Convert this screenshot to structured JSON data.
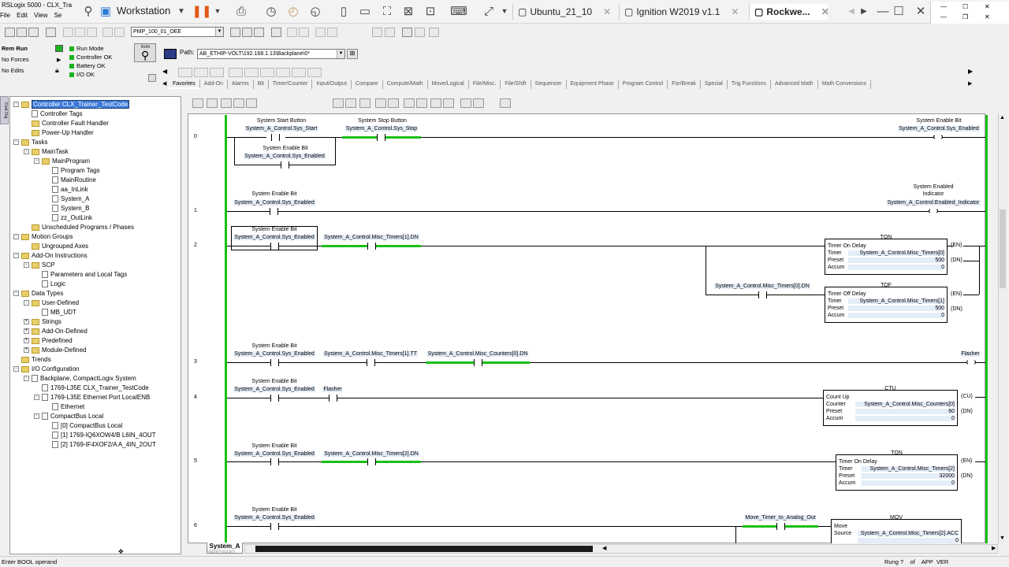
{
  "app": {
    "title": "RSLogix 5000 - CLX_Tra",
    "menu": [
      "File",
      "Edit",
      "View",
      "Se"
    ]
  },
  "vm": {
    "workstation_label": "Workstation",
    "tabs": [
      {
        "label": "Ubuntu_21_10"
      },
      {
        "label": "Ignition W2019 v1.1"
      },
      {
        "label": "Rockwe..."
      }
    ]
  },
  "toolbar": {
    "routine_combo": "PMP_100_01_OEE"
  },
  "controller_status": {
    "mode": "Rem Run",
    "forces": "No Forces",
    "edits": "No Edits",
    "indicators": [
      "Run Mode",
      "Controller OK",
      "Battery OK",
      "I/O OK"
    ],
    "keyswitch_label": "RUN"
  },
  "path": {
    "label": "Path:",
    "value": "AB_ETHIP-VOLT\\192.168.1.13\\Backplane\\0*"
  },
  "instruction_tabs": [
    "Favorites",
    "Add-On",
    "Alarms",
    "Bit",
    "Timer/Counter",
    "Input/Output",
    "Compare",
    "Compute/Math",
    "Move/Logical",
    "File/Misc.",
    "File/Shift",
    "Sequencer",
    "Equipment Phase",
    "Program Control",
    "For/Break",
    "Special",
    "Trig Functions",
    "Advanced Math",
    "Math Conversions"
  ],
  "tree": [
    {
      "label": "Controller CLX_Trainer_TestCode",
      "indent": 0,
      "icon": "folder",
      "exp": "-",
      "selected": true
    },
    {
      "label": "Controller Tags",
      "indent": 1,
      "icon": "page"
    },
    {
      "label": "Controller Fault Handler",
      "indent": 1,
      "icon": "folder"
    },
    {
      "label": "Power-Up Handler",
      "indent": 1,
      "icon": "folder"
    },
    {
      "label": "Tasks",
      "indent": 0,
      "icon": "folder",
      "exp": "-"
    },
    {
      "label": "MainTask",
      "indent": 1,
      "icon": "folder",
      "exp": "-"
    },
    {
      "label": "MainProgram",
      "indent": 2,
      "icon": "folder",
      "exp": "-"
    },
    {
      "label": "Program Tags",
      "indent": 3,
      "icon": "page"
    },
    {
      "label": "MainRoutine",
      "indent": 3,
      "icon": "page"
    },
    {
      "label": "aa_InLink",
      "indent": 3,
      "icon": "page"
    },
    {
      "label": "System_A",
      "indent": 3,
      "icon": "page"
    },
    {
      "label": "System_B",
      "indent": 3,
      "icon": "page"
    },
    {
      "label": "zz_OutLink",
      "indent": 3,
      "icon": "page"
    },
    {
      "label": "Unscheduled Programs / Phases",
      "indent": 1,
      "icon": "folder"
    },
    {
      "label": "Motion Groups",
      "indent": 0,
      "icon": "folder",
      "exp": "-"
    },
    {
      "label": "Ungrouped Axes",
      "indent": 1,
      "icon": "folder"
    },
    {
      "label": "Add-On Instructions",
      "indent": 0,
      "icon": "folder",
      "exp": "-"
    },
    {
      "label": "SCP",
      "indent": 1,
      "icon": "folder",
      "exp": "-"
    },
    {
      "label": "Parameters and Local Tags",
      "indent": 2,
      "icon": "page"
    },
    {
      "label": "Logic",
      "indent": 2,
      "icon": "page"
    },
    {
      "label": "Data Types",
      "indent": 0,
      "icon": "folder",
      "exp": "-"
    },
    {
      "label": "User-Defined",
      "indent": 1,
      "icon": "folder",
      "exp": "-"
    },
    {
      "label": "MB_UDT",
      "indent": 2,
      "icon": "page"
    },
    {
      "label": "Strings",
      "indent": 1,
      "icon": "folder",
      "exp": "+"
    },
    {
      "label": "Add-On-Defined",
      "indent": 1,
      "icon": "folder",
      "exp": "+"
    },
    {
      "label": "Predefined",
      "indent": 1,
      "icon": "folder",
      "exp": "+"
    },
    {
      "label": "Module-Defined",
      "indent": 1,
      "icon": "folder",
      "exp": "+"
    },
    {
      "label": "Trends",
      "indent": 0,
      "icon": "folder"
    },
    {
      "label": "I/O Configuration",
      "indent": 0,
      "icon": "folder",
      "exp": "-"
    },
    {
      "label": "Backplane, CompactLogix System",
      "indent": 1,
      "icon": "page",
      "exp": "-"
    },
    {
      "label": "1769-L35E CLX_Trainer_TestCode",
      "indent": 2,
      "icon": "page"
    },
    {
      "label": "1769-L35E Ethernet Port LocalENB",
      "indent": 2,
      "icon": "page",
      "exp": "-"
    },
    {
      "label": "Ethernet",
      "indent": 3,
      "icon": "page"
    },
    {
      "label": "CompactBus Local",
      "indent": 2,
      "icon": "page",
      "exp": "-"
    },
    {
      "label": "[0] CompactBus Local",
      "indent": 3,
      "icon": "page"
    },
    {
      "label": "[1] 1769-IQ6XOW4/B L6IN_4OUT",
      "indent": 3,
      "icon": "page"
    },
    {
      "label": "[2] 1769-IF4XOF2/A A_4IN_2OUT",
      "indent": 3,
      "icon": "page"
    }
  ],
  "ladder": {
    "rung_numbers": [
      "0",
      "1",
      "2",
      "3",
      "4",
      "5",
      "6"
    ],
    "r0": {
      "c1_desc": "System Start Button",
      "c1_tag": "System_A_Control.Sys_Start",
      "c2_desc": "System Enable Bit",
      "c2_tag": "System_A_Control.Sys_Enabled",
      "c3_desc": "System Stop Button",
      "c3_tag": "System_A_Control.Sys_Stop",
      "out_desc": "System Enable Bit",
      "out_tag": "System_A_Control.Sys_Enabled"
    },
    "r1": {
      "c1_desc": "System Enable Bit",
      "c1_tag": "System_A_Control.Sys_Enabled",
      "out_desc1": "System Enabled",
      "out_desc2": "Indicator",
      "out_tag": "System_A_Control.Enabled_Indicator"
    },
    "r2": {
      "c1_desc": "System Enable Bit",
      "c1_tag": "System_A_Control.Sys_Enabled",
      "c2_tag": "System_A_Control.Misc_Timers[1].DN",
      "c3_tag": "System_A_Control.Misc_Timers[0].DN",
      "ton": {
        "type": "TON",
        "title": "Timer On Delay",
        "timer_lbl": "Timer",
        "timer": "System_A_Control.Misc_Timers[0]",
        "preset_lbl": "Preset",
        "preset": "500",
        "accum_lbl": "Accum",
        "accum": "0",
        "en": "EN",
        "dn": "DN"
      },
      "tof": {
        "type": "TOF",
        "title": "Timer Off Delay",
        "timer_lbl": "Timer",
        "timer": "System_A_Control.Misc_Timers[1]",
        "preset_lbl": "Preset",
        "preset": "500",
        "accum_lbl": "Accum",
        "accum": "0",
        "en": "EN",
        "dn": "DN"
      }
    },
    "r3": {
      "c1_desc": "System Enable Bit",
      "c1_tag": "System_A_Control.Sys_Enabled",
      "c2_tag": "System_A_Control.Misc_Timers[1].TT",
      "c3_tag": "System_A_Control.Misc_Counters[0].DN",
      "out_desc": "Flasher"
    },
    "r4": {
      "c1_desc": "System Enable Bit",
      "c1_tag": "System_A_Control.Sys_Enabled",
      "c2_tag": "Flasher",
      "ctu": {
        "type": "CTU",
        "title": "Count Up",
        "counter_lbl": "Counter",
        "counter": "System_A_Control.Misc_Counters[0]",
        "preset_lbl": "Preset",
        "preset": "60",
        "accum_lbl": "Accum",
        "accum": "0",
        "cu": "CU",
        "dn": "DN"
      }
    },
    "r5": {
      "c1_desc": "System Enable Bit",
      "c1_tag": "System_A_Control.Sys_Enabled",
      "c2_tag": "System_A_Control.Misc_Timers[2].DN",
      "ton": {
        "type": "TON",
        "title": "Timer On Delay",
        "timer_lbl": "Timer",
        "timer": "System_A_Control.Misc_Timers[2]",
        "preset_lbl": "Preset",
        "preset": "32000",
        "accum_lbl": "Accum",
        "accum": "0",
        "en": "EN",
        "dn": "DN"
      }
    },
    "r6": {
      "c1_desc": "System Enable Bit",
      "c1_tag": "System_A_Control.Sys_Enabled",
      "c2_tag": "Move_Timer_to_Analog_Out",
      "mov": {
        "type": "MOV",
        "title": "Move",
        "source_lbl": "Source",
        "source": "System_A_Control.Misc_Timers[2].ACC",
        "source_val": "0"
      }
    }
  },
  "sheet": {
    "tab": "System_A",
    "sub": "MainProgram"
  },
  "statusbar": {
    "left": "Enter BOOL operand",
    "rung": "Rung ?",
    "of": "of",
    "app": "APP",
    "ver": "VER"
  },
  "colors": {
    "energized": "#19c019",
    "selection": "#3b78d8",
    "tag_bg": "#e4edf8"
  }
}
